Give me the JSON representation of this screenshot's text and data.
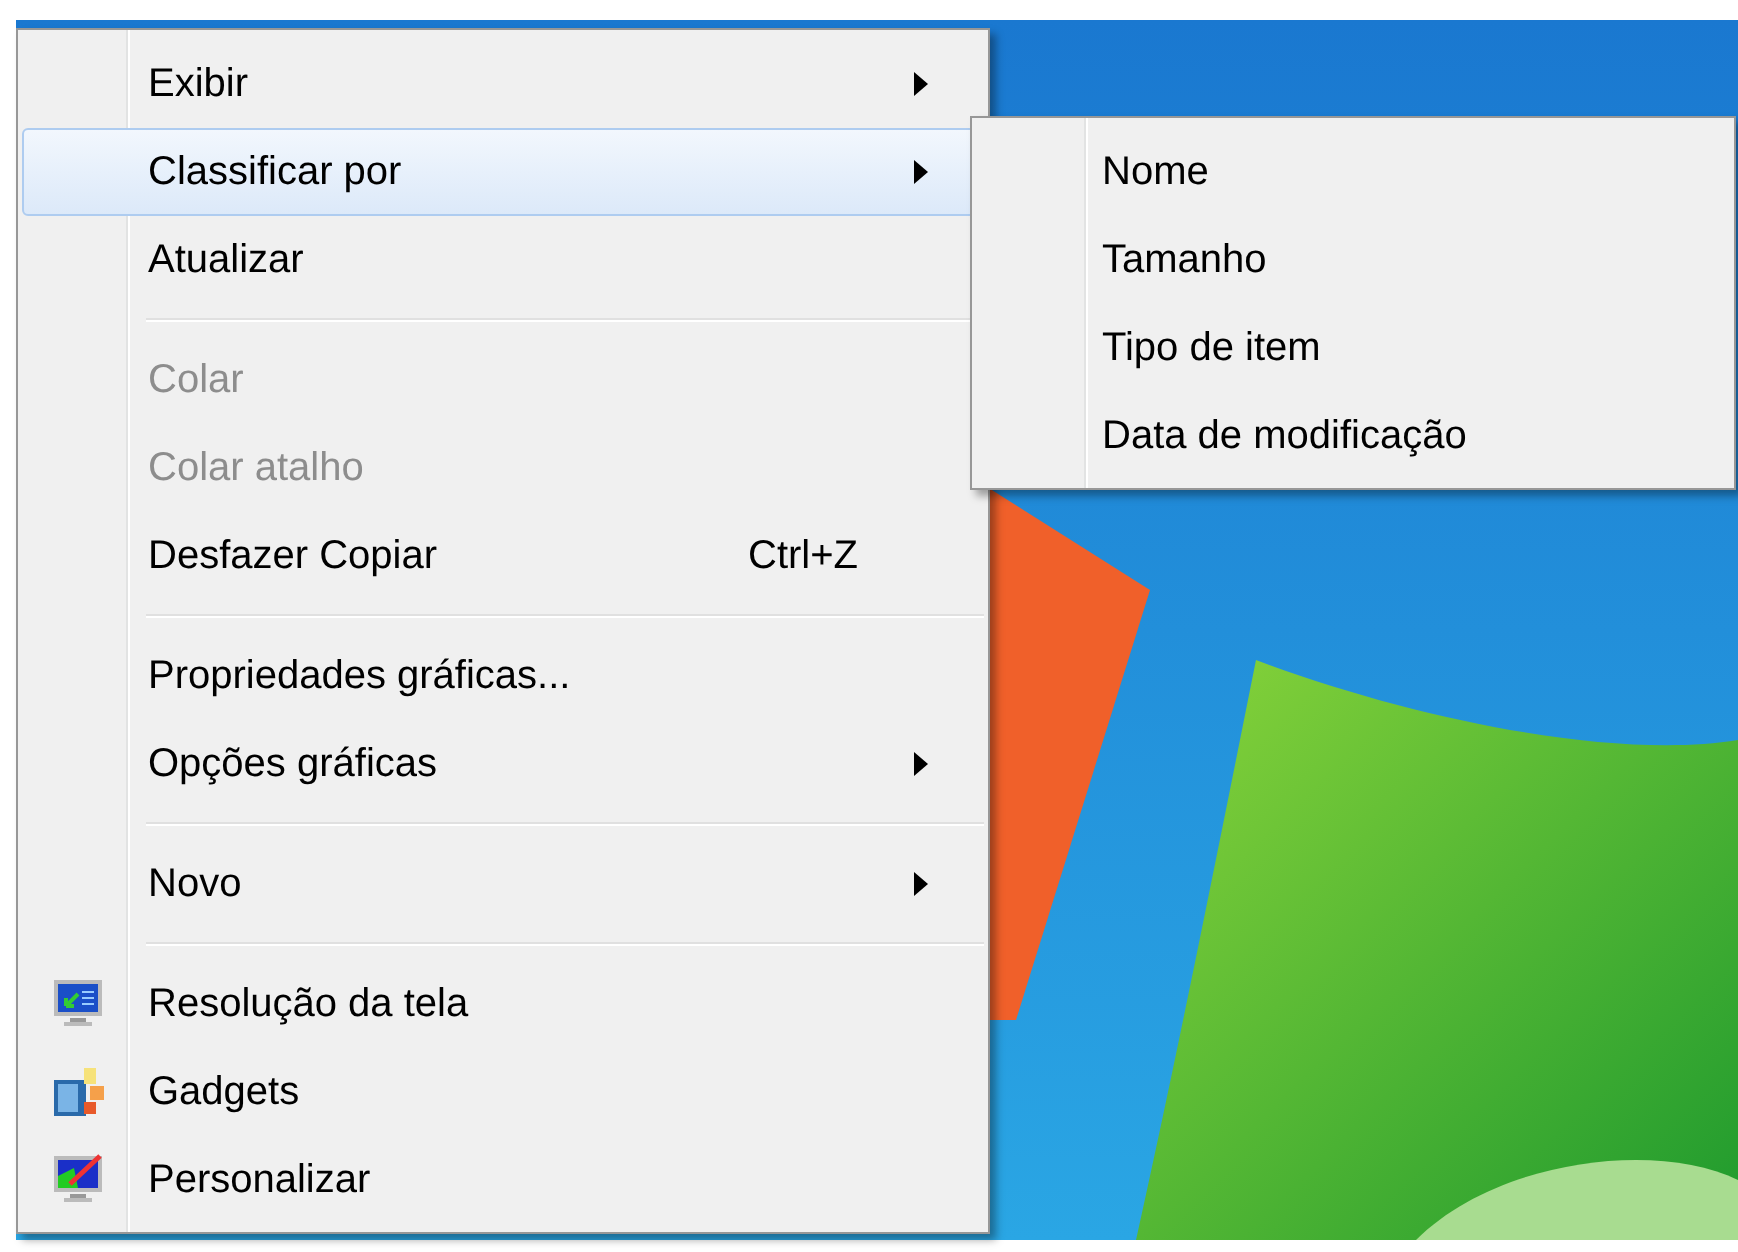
{
  "context_menu": {
    "items": [
      {
        "kind": "item",
        "label": "Exibir",
        "has_submenu": true,
        "selected": false,
        "disabled": false
      },
      {
        "kind": "item",
        "label": "Classificar por",
        "has_submenu": true,
        "selected": true,
        "disabled": false,
        "submenu": [
          {
            "label": "Nome"
          },
          {
            "label": "Tamanho"
          },
          {
            "label": "Tipo de item"
          },
          {
            "label": "Data de modificação"
          }
        ]
      },
      {
        "kind": "item",
        "label": "Atualizar",
        "has_submenu": false,
        "selected": false,
        "disabled": false
      },
      {
        "kind": "separator"
      },
      {
        "kind": "item",
        "label": "Colar",
        "has_submenu": false,
        "selected": false,
        "disabled": true
      },
      {
        "kind": "item",
        "label": "Colar atalho",
        "has_submenu": false,
        "selected": false,
        "disabled": true
      },
      {
        "kind": "item",
        "label": "Desfazer Copiar",
        "shortcut": "Ctrl+Z",
        "has_submenu": false,
        "selected": false,
        "disabled": false
      },
      {
        "kind": "separator"
      },
      {
        "kind": "item",
        "label": "Propriedades gráficas...",
        "has_submenu": false,
        "selected": false,
        "disabled": false
      },
      {
        "kind": "item",
        "label": "Opções gráficas",
        "has_submenu": true,
        "selected": false,
        "disabled": false
      },
      {
        "kind": "separator"
      },
      {
        "kind": "item",
        "label": "Novo",
        "has_submenu": true,
        "selected": false,
        "disabled": false
      },
      {
        "kind": "separator"
      },
      {
        "kind": "item",
        "label": "Resolução da tela",
        "has_icon": true,
        "has_submenu": false,
        "selected": false,
        "disabled": false
      },
      {
        "kind": "item",
        "label": "Gadgets",
        "has_icon": true,
        "has_submenu": false,
        "selected": false,
        "disabled": false
      },
      {
        "kind": "item",
        "label": "Personalizar",
        "has_icon": true,
        "has_submenu": false,
        "selected": false,
        "disabled": false
      }
    ]
  }
}
